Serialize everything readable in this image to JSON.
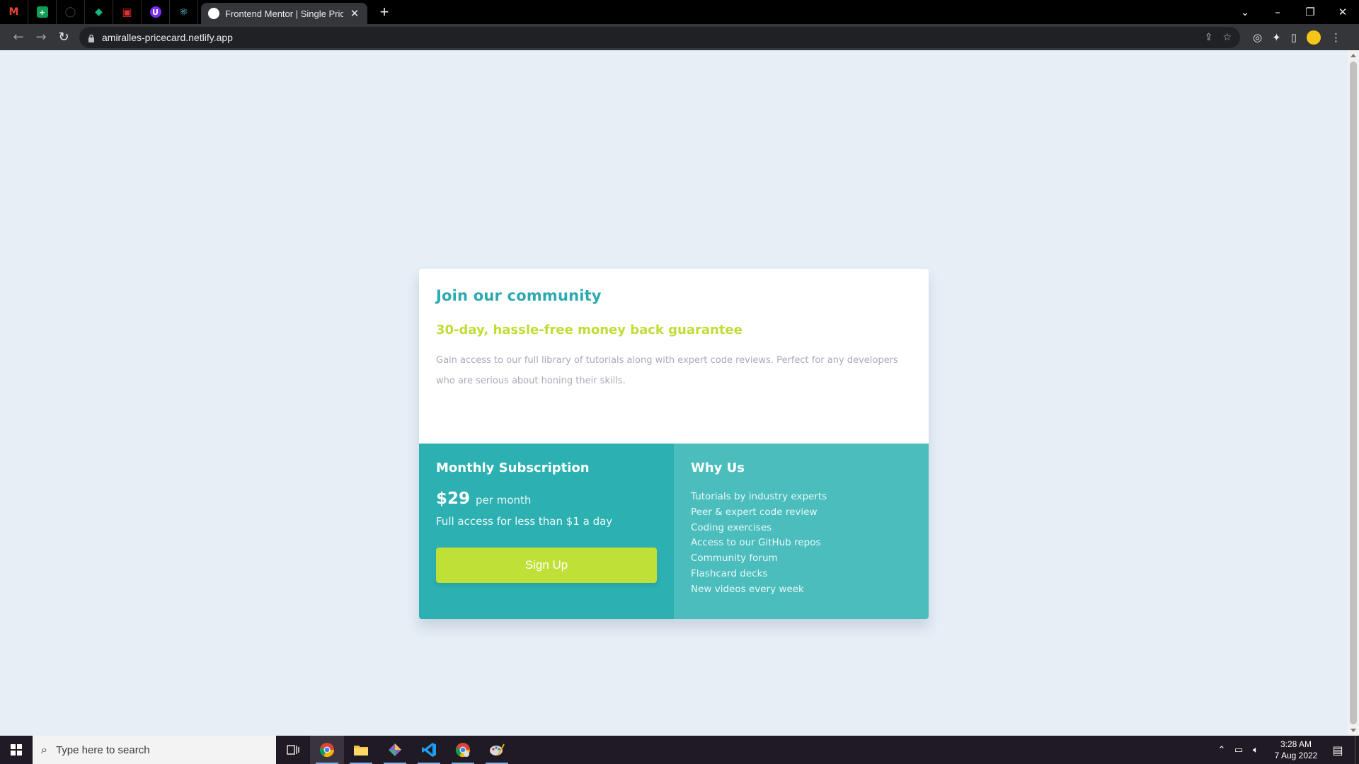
{
  "browser": {
    "pinned_tabs": [
      {
        "name": "gmail",
        "glyph": "M",
        "color": "#ea4335",
        "bg": "transparent"
      },
      {
        "name": "sheets",
        "glyph": "+",
        "color": "#ffffff",
        "bg": "#0f9d58"
      },
      {
        "name": "github",
        "glyph": "◯",
        "color": "#3a3a3a",
        "bg": "transparent"
      },
      {
        "name": "app-diamond",
        "glyph": "◆",
        "color": "#12b886",
        "bg": "transparent"
      },
      {
        "name": "app-red",
        "glyph": "▣",
        "color": "#e03131",
        "bg": "transparent"
      },
      {
        "name": "app-purple",
        "glyph": "U",
        "color": "#ffffff",
        "bg": "#7b2ff7"
      },
      {
        "name": "react",
        "glyph": "⚛",
        "color": "#61dafb",
        "bg": "transparent"
      }
    ],
    "active_tab_title": "Frontend Mentor | Single Price G",
    "url": "amiralles-pricecard.netlify.app"
  },
  "card": {
    "title": "Join our community",
    "subtitle": "30-day, hassle-free money back guarantee",
    "description": "Gain access to our full library of tutorials along with expert code reviews. Perfect for any developers who are serious about honing their skills.",
    "subscription": {
      "heading": "Monthly Subscription",
      "price": "$29",
      "period": "per month",
      "access_text": "Full access for less than $1 a day",
      "button_label": "Sign Up"
    },
    "why_us": {
      "heading": "Why Us",
      "items": [
        "Tutorials by industry experts",
        "Peer & expert code review",
        "Coding exercises",
        "Access to our GitHub repos",
        "Community forum",
        "Flashcard decks",
        "New videos every week"
      ]
    }
  },
  "colors": {
    "page_bg": "#e6eef6",
    "title_teal": "#2baab0",
    "subtitle_lime": "#bfdd35",
    "left_panel": "#2cb0b1",
    "right_panel": "#4bbdbd",
    "button_lime": "#bfe036"
  },
  "taskbar": {
    "search_placeholder": "Type here to search",
    "time": "3:28 AM",
    "date": "7 Aug 2022"
  }
}
